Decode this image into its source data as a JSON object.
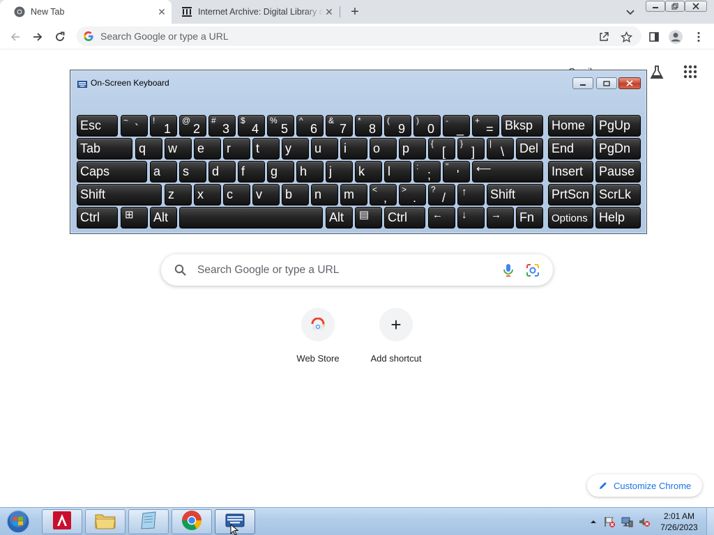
{
  "browser": {
    "tabs": [
      {
        "title": "New Tab",
        "icon": "chrome-icon",
        "active": true
      },
      {
        "title": "Internet Archive: Digital Library of Free & Borrowable Books, Movies, Music & Wayback Machine",
        "icon": "internet-archive-icon",
        "active": false
      }
    ],
    "new_tab_symbol": "+",
    "close_symbol": "✕",
    "omnibox": {
      "placeholder": "Search Google or type a URL"
    }
  },
  "ntp": {
    "header_link": "Gmail",
    "search_placeholder": "Search Google or type a URL",
    "shortcuts": [
      {
        "label": "Web Store",
        "icon": "web-store-icon"
      },
      {
        "label": "Add shortcut",
        "icon": "plus-icon",
        "symbol": "+"
      }
    ],
    "customize_label": "Customize Chrome"
  },
  "osk": {
    "title": "On-Screen Keyboard",
    "rows": [
      [
        {
          "label": "Esc"
        },
        {
          "sub": "~",
          "main": "`"
        },
        {
          "sub": "!",
          "main": "1"
        },
        {
          "sub": "@",
          "main": "2"
        },
        {
          "sub": "#",
          "main": "3"
        },
        {
          "sub": "$",
          "main": "4"
        },
        {
          "sub": "%",
          "main": "5"
        },
        {
          "sub": "^",
          "main": "6"
        },
        {
          "sub": "&",
          "main": "7"
        },
        {
          "sub": "*",
          "main": "8"
        },
        {
          "sub": "(",
          "main": "9"
        },
        {
          "sub": ")",
          "main": "0"
        },
        {
          "sub": "-",
          "main": "_"
        },
        {
          "sub": "+",
          "main": "="
        },
        {
          "label": "Bksp"
        },
        {
          "label": "Home"
        },
        {
          "label": "PgUp"
        }
      ],
      [
        {
          "label": "Tab"
        },
        {
          "label": "q"
        },
        {
          "label": "w"
        },
        {
          "label": "e"
        },
        {
          "label": "r"
        },
        {
          "label": "t"
        },
        {
          "label": "y"
        },
        {
          "label": "u"
        },
        {
          "label": "i"
        },
        {
          "label": "o"
        },
        {
          "label": "p"
        },
        {
          "sub": "{",
          "main": "["
        },
        {
          "sub": "}",
          "main": "]"
        },
        {
          "sub": "|",
          "main": "\\"
        },
        {
          "label": "Del"
        },
        {
          "label": "End"
        },
        {
          "label": "PgDn"
        }
      ],
      [
        {
          "label": "Caps"
        },
        {
          "label": "a"
        },
        {
          "label": "s"
        },
        {
          "label": "d"
        },
        {
          "label": "f"
        },
        {
          "label": "g"
        },
        {
          "label": "h"
        },
        {
          "label": "j"
        },
        {
          "label": "k"
        },
        {
          "label": "l"
        },
        {
          "sub": ":",
          "main": ";"
        },
        {
          "sub": "\"",
          "main": "'"
        },
        {
          "label": "⟵"
        },
        {
          "label": "Insert"
        },
        {
          "label": "Pause"
        }
      ],
      [
        {
          "label": "Shift"
        },
        {
          "label": "z"
        },
        {
          "label": "x"
        },
        {
          "label": "c"
        },
        {
          "label": "v"
        },
        {
          "label": "b"
        },
        {
          "label": "n"
        },
        {
          "label": "m"
        },
        {
          "sub": "<",
          "main": ","
        },
        {
          "sub": ">",
          "main": "."
        },
        {
          "sub": "?",
          "main": "/"
        },
        {
          "label": "↑"
        },
        {
          "label": "Shift"
        },
        {
          "label": "PrtScn"
        },
        {
          "label": "ScrLk"
        }
      ],
      [
        {
          "label": "Ctrl"
        },
        {
          "label": "⊞"
        },
        {
          "label": "Alt"
        },
        {
          "label": ""
        },
        {
          "label": "Alt"
        },
        {
          "label": "▤"
        },
        {
          "label": "Ctrl"
        },
        {
          "label": "←"
        },
        {
          "label": "↓"
        },
        {
          "label": "→"
        },
        {
          "label": "Fn"
        },
        {
          "label": "Options"
        },
        {
          "label": "Help"
        }
      ]
    ]
  },
  "taskbar": {
    "apps": [
      {
        "name": "Adobe Acrobat",
        "icon": "adobe-icon"
      },
      {
        "name": "File Explorer",
        "icon": "folder-icon"
      },
      {
        "name": "Notepad",
        "icon": "notepad-icon"
      },
      {
        "name": "Google Chrome",
        "icon": "chrome-icon"
      },
      {
        "name": "On-Screen Keyboard",
        "icon": "keyboard-icon"
      }
    ],
    "time": "2:01 AM",
    "date": "7/26/2023"
  },
  "colors": {
    "accent_blue": "#1a73e8",
    "key_face": "#1e1e1e",
    "osk_frame": "#b7cde6",
    "tab_strip": "#dee1e6"
  }
}
